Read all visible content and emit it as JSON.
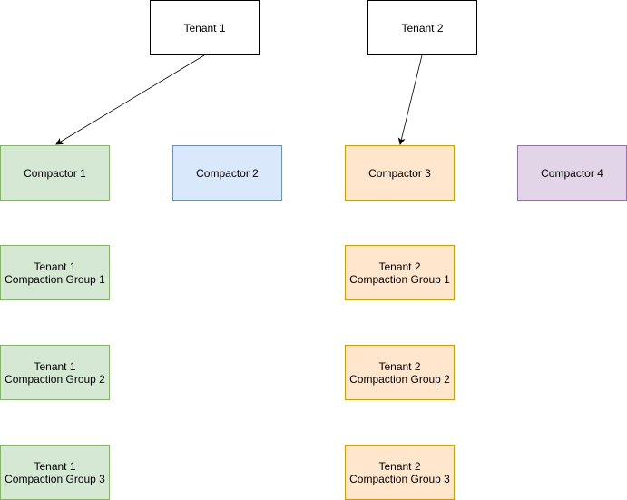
{
  "diagram": {
    "tenants": [
      {
        "id": "tenant1",
        "label": "Tenant 1",
        "style": "white"
      },
      {
        "id": "tenant2",
        "label": "Tenant 2",
        "style": "white"
      }
    ],
    "compactors": [
      {
        "id": "compactor1",
        "label": "Compactor 1",
        "style": "green"
      },
      {
        "id": "compactor2",
        "label": "Compactor 2",
        "style": "blue"
      },
      {
        "id": "compactor3",
        "label": "Compactor 3",
        "style": "orange"
      },
      {
        "id": "compactor4",
        "label": "Compactor 4",
        "style": "purple"
      }
    ],
    "groups": [
      {
        "id": "t1g1",
        "line1": "Tenant 1",
        "line2": "Compaction Group 1",
        "style": "green"
      },
      {
        "id": "t1g2",
        "line1": "Tenant 1",
        "line2": "Compaction Group 2",
        "style": "green"
      },
      {
        "id": "t1g3",
        "line1": "Tenant 1",
        "line2": "Compaction Group 3",
        "style": "green"
      },
      {
        "id": "t2g1",
        "line1": "Tenant 2",
        "line2": "Compaction Group 1",
        "style": "orange"
      },
      {
        "id": "t2g2",
        "line1": "Tenant 2",
        "line2": "Compaction Group 2",
        "style": "orange"
      },
      {
        "id": "t2g3",
        "line1": "Tenant 2",
        "line2": "Compaction Group 3",
        "style": "orange"
      }
    ],
    "edges": [
      {
        "from": "tenant1",
        "to": "compactor1"
      },
      {
        "from": "tenant2",
        "to": "compactor3"
      }
    ],
    "colors": {
      "green_fill": "#d5e8d4",
      "green_stroke": "#82b366",
      "blue_fill": "#dae8fc",
      "blue_stroke": "#6c8ebf",
      "orange_fill": "#ffe6cc",
      "orange_stroke": "#d79b00",
      "purple_fill": "#e1d5e7",
      "purple_stroke": "#9673a6"
    }
  }
}
